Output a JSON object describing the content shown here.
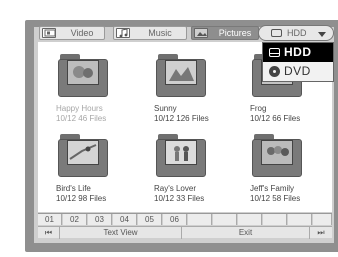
{
  "tabs": [
    {
      "label": "Video",
      "icon": "film-icon",
      "active": false
    },
    {
      "label": "Music",
      "icon": "music-note-icon",
      "active": false
    },
    {
      "label": "Pictures",
      "icon": "picture-icon",
      "active": true
    }
  ],
  "device_selector": {
    "current": "HDD",
    "options": [
      {
        "label": "HDD",
        "icon": "hard-drive-icon",
        "selected": true
      },
      {
        "label": "DVD",
        "icon": "disc-icon",
        "selected": false
      }
    ]
  },
  "folders": [
    {
      "name": "Happy Hours",
      "meta": "10/12 46 Files",
      "dimmed": true
    },
    {
      "name": "Sunny",
      "meta": "10/12 126 Files",
      "dimmed": false
    },
    {
      "name": "Frog",
      "meta": "10/12 66 Files",
      "dimmed": false
    },
    {
      "name": "Bird's Life",
      "meta": "10/12 98 Files",
      "dimmed": false
    },
    {
      "name": "Ray's Lover",
      "meta": "10/12 33 Files",
      "dimmed": false
    },
    {
      "name": "Jeff's Family",
      "meta": "10/12 58 Files",
      "dimmed": false
    }
  ],
  "pages": [
    "01",
    "02",
    "03",
    "04",
    "05",
    "06"
  ],
  "bottom_bar": {
    "prev": "⏮",
    "text_view": "Text View",
    "exit": "Exit",
    "next": "⏭"
  }
}
